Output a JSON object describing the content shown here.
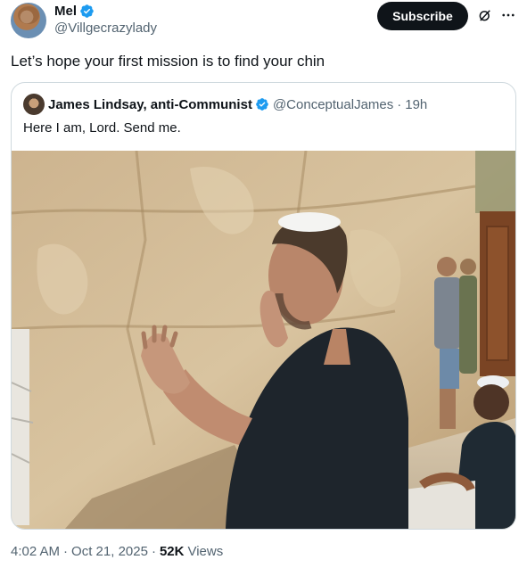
{
  "author": {
    "display_name": "Mel",
    "handle": "@Villgecrazylady",
    "verified_color": "#1d9bf0"
  },
  "actions": {
    "subscribe_label": "Subscribe",
    "grok_icon": "grok-icon",
    "more_icon": "more-dots-icon"
  },
  "tweet": {
    "text": "Let’s hope your first mission is to find your chin",
    "time": "4:02 AM",
    "date": "Oct 21, 2025",
    "views_count": "52K",
    "views_label": "Views"
  },
  "quoted": {
    "display_name": "James Lindsay, anti-Communist",
    "handle": "@ConceptualJames",
    "age": "19h",
    "text": "Here I am, Lord. Send me."
  },
  "colors": {
    "text": "#0f1419",
    "muted": "#536471",
    "border": "#cfd9de",
    "verified": "#1d9bf0"
  }
}
